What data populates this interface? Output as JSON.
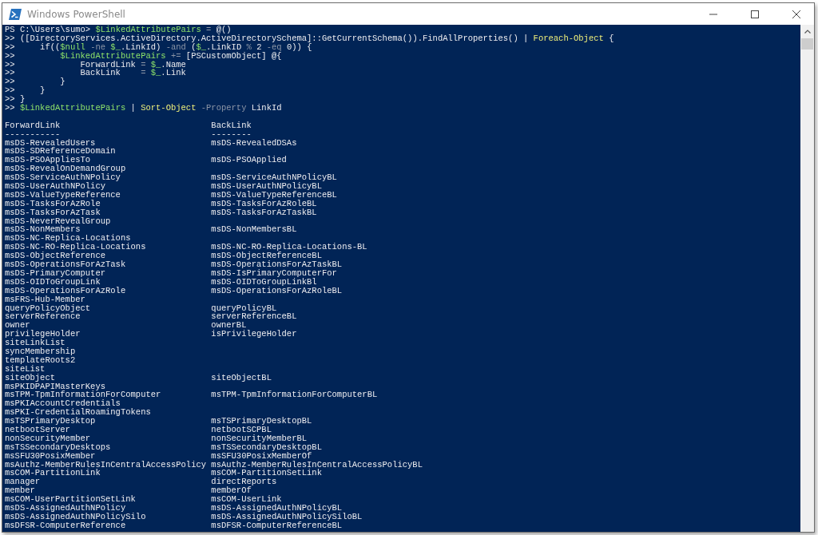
{
  "window": {
    "title": "Windows PowerShell"
  },
  "code_lines": [
    [
      {
        "text": "PS C:\\Users\\sumo> ",
        "kind": "plain"
      },
      {
        "text": "$LinkedAttributePairs",
        "kind": "variable"
      },
      {
        "text": " = ",
        "kind": "operator"
      },
      {
        "text": "@()",
        "kind": "plain"
      }
    ],
    [
      {
        "text": ">> ([DirectoryServices.ActiveDirectory.ActiveDirectorySchema]::GetCurrentSchema()).FindAllProperties() | ",
        "kind": "plain"
      },
      {
        "text": "Foreach-Object",
        "kind": "command"
      },
      {
        "text": " {",
        "kind": "plain"
      }
    ],
    [
      {
        "text": ">>     if((",
        "kind": "plain"
      },
      {
        "text": "$null",
        "kind": "variable"
      },
      {
        "text": " -ne ",
        "kind": "operator"
      },
      {
        "text": "$_",
        "kind": "variable"
      },
      {
        "text": ".LinkId) ",
        "kind": "plain"
      },
      {
        "text": "-and",
        "kind": "operator"
      },
      {
        "text": " (",
        "kind": "plain"
      },
      {
        "text": "$_",
        "kind": "variable"
      },
      {
        "text": ".LinkID ",
        "kind": "plain"
      },
      {
        "text": "%",
        "kind": "operator"
      },
      {
        "text": " 2 ",
        "kind": "plain"
      },
      {
        "text": "-eq",
        "kind": "operator"
      },
      {
        "text": " 0)) {",
        "kind": "plain"
      }
    ],
    [
      {
        "text": ">>         ",
        "kind": "plain"
      },
      {
        "text": "$LinkedAttributePairs",
        "kind": "variable"
      },
      {
        "text": " += ",
        "kind": "operator"
      },
      {
        "text": "[PSCustomObject] @{",
        "kind": "plain"
      }
    ],
    [
      {
        "text": ">>             ForwardLink ",
        "kind": "plain"
      },
      {
        "text": "= ",
        "kind": "operator"
      },
      {
        "text": "$_",
        "kind": "variable"
      },
      {
        "text": ".Name",
        "kind": "plain"
      }
    ],
    [
      {
        "text": ">>             BackLink    ",
        "kind": "plain"
      },
      {
        "text": "= ",
        "kind": "operator"
      },
      {
        "text": "$_",
        "kind": "variable"
      },
      {
        "text": ".Link",
        "kind": "plain"
      }
    ],
    [
      {
        "text": ">>         }",
        "kind": "plain"
      }
    ],
    [
      {
        "text": ">>     }",
        "kind": "plain"
      }
    ],
    [
      {
        "text": ">> }",
        "kind": "plain"
      }
    ],
    [
      {
        "text": ">> ",
        "kind": "plain"
      },
      {
        "text": "$LinkedAttributePairs",
        "kind": "variable"
      },
      {
        "text": " | ",
        "kind": "plain"
      },
      {
        "text": "Sort-Object",
        "kind": "command"
      },
      {
        "text": " -Property",
        "kind": "operator"
      },
      {
        "text": " LinkId",
        "kind": "plain"
      }
    ]
  ],
  "table": {
    "columns": [
      "ForwardLink",
      "BackLink"
    ],
    "underlines": [
      "-----------",
      "--------"
    ],
    "rows": [
      {
        "forward": "msDS-RevealedUsers",
        "back": "msDS-RevealedDSAs"
      },
      {
        "forward": "msDS-SDReferenceDomain"
      },
      {
        "forward": "msDS-PSOAppliesTo",
        "back": "msDS-PSOApplied"
      },
      {
        "forward": "msDS-RevealOnDemandGroup"
      },
      {
        "forward": "msDS-ServiceAuthNPolicy",
        "back": "msDS-ServiceAuthNPolicyBL"
      },
      {
        "forward": "msDS-UserAuthNPolicy",
        "back": "msDS-UserAuthNPolicyBL"
      },
      {
        "forward": "msDS-ValueTypeReference",
        "back": "msDS-ValueTypeReferenceBL"
      },
      {
        "forward": "msDS-TasksForAzRole",
        "back": "msDS-TasksForAzRoleBL"
      },
      {
        "forward": "msDS-TasksForAzTask",
        "back": "msDS-TasksForAzTaskBL"
      },
      {
        "forward": "msDS-NeverRevealGroup"
      },
      {
        "forward": "msDS-NonMembers",
        "back": "msDS-NonMembersBL"
      },
      {
        "forward": "msDS-NC-Replica-Locations"
      },
      {
        "forward": "msDS-NC-RO-Replica-Locations",
        "back": "msDS-NC-RO-Replica-Locations-BL"
      },
      {
        "forward": "msDS-ObjectReference",
        "back": "msDS-ObjectReferenceBL"
      },
      {
        "forward": "msDS-OperationsForAzTask",
        "back": "msDS-OperationsForAzTaskBL"
      },
      {
        "forward": "msDS-PrimaryComputer",
        "back": "msDS-IsPrimaryComputerFor"
      },
      {
        "forward": "msDS-OIDToGroupLink",
        "back": "msDS-OIDToGroupLinkBl"
      },
      {
        "forward": "msDS-OperationsForAzRole",
        "back": "msDS-OperationsForAzRoleBL"
      },
      {
        "forward": "msFRS-Hub-Member"
      },
      {
        "forward": "queryPolicyObject",
        "back": "queryPolicyBL"
      },
      {
        "forward": "serverReference",
        "back": "serverReferenceBL"
      },
      {
        "forward": "owner",
        "back": "ownerBL"
      },
      {
        "forward": "privilegeHolder",
        "back": "isPrivilegeHolder"
      },
      {
        "forward": "siteLinkList"
      },
      {
        "forward": "syncMembership"
      },
      {
        "forward": "templateRoots2"
      },
      {
        "forward": "siteList"
      },
      {
        "forward": "siteObject",
        "back": "siteObjectBL"
      },
      {
        "forward": "msPKIDPAPIMasterKeys"
      },
      {
        "forward": "msTPM-TpmInformationForComputer",
        "back": "msTPM-TpmInformationForComputerBL"
      },
      {
        "forward": "msPKIAccountCredentials"
      },
      {
        "forward": "msPKI-CredentialRoamingTokens"
      },
      {
        "forward": "msTSPrimaryDesktop",
        "back": "msTSPrimaryDesktopBL"
      },
      {
        "forward": "netbootServer",
        "back": "netbootSCPBL"
      },
      {
        "forward": "nonSecurityMember",
        "back": "nonSecurityMemberBL"
      },
      {
        "forward": "msTSSecondaryDesktops",
        "back": "msTSSecondaryDesktopBL"
      },
      {
        "forward": "msSFU30PosixMember",
        "back": "msSFU30PosixMemberOf"
      },
      {
        "forward": "msAuthz-MemberRulesInCentralAccessPolicy",
        "back": "msAuthz-MemberRulesInCentralAccessPolicyBL"
      },
      {
        "forward": "msCOM-PartitionLink",
        "back": "msCOM-PartitionSetLink"
      },
      {
        "forward": "manager",
        "back": "directReports"
      },
      {
        "forward": "member",
        "back": "memberOf"
      },
      {
        "forward": "msCOM-UserPartitionSetLink",
        "back": "msCOM-UserLink"
      },
      {
        "forward": "msDS-AssignedAuthNPolicy",
        "back": "msDS-AssignedAuthNPolicyBL"
      },
      {
        "forward": "msDS-AssignedAuthNPolicySilo",
        "back": "msDS-AssignedAuthNPolicySiloBL"
      },
      {
        "forward": "msDFSR-ComputerReference",
        "back": "msDFSR-ComputerReferenceBL"
      }
    ]
  }
}
